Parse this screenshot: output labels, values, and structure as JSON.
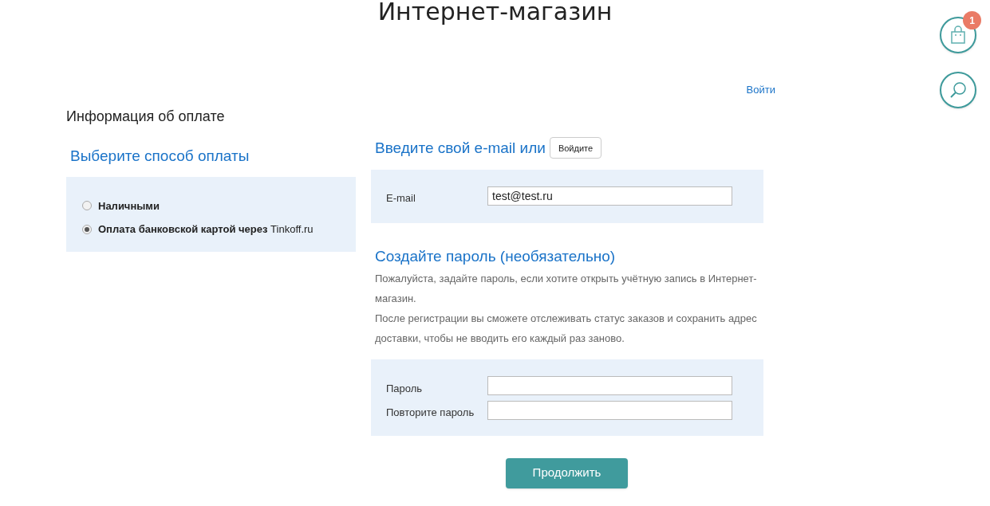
{
  "header": {
    "title": "Интернет-магазин"
  },
  "floating": {
    "cart_count": "1"
  },
  "login_link": "Войти",
  "page_title": "Информация об оплате",
  "payment": {
    "heading": "Выберите способ оплаты",
    "options": [
      {
        "label": "Наличными",
        "selected": false
      },
      {
        "label": "Оплата банковской картой через",
        "provider": "Tinkoff.ru",
        "selected": true
      }
    ]
  },
  "email_section": {
    "heading": "Введите свой e-mail или",
    "button": "Войдите",
    "label": "E-mail",
    "value": "test@test.ru"
  },
  "password_section": {
    "heading": "Создайте пароль (необязательно)",
    "paragraphs": [
      "Пожалуйста, задайте пароль, если хотите открыть учётную запись в Интернет-магазин.",
      "После регистрации вы сможете отслеживать статус заказов и сохранить адрес доставки, чтобы не вводить его каждый раз заново."
    ],
    "fields": [
      {
        "label": "Пароль"
      },
      {
        "label": "Повторите пароль"
      }
    ]
  },
  "submit": "Продолжить"
}
